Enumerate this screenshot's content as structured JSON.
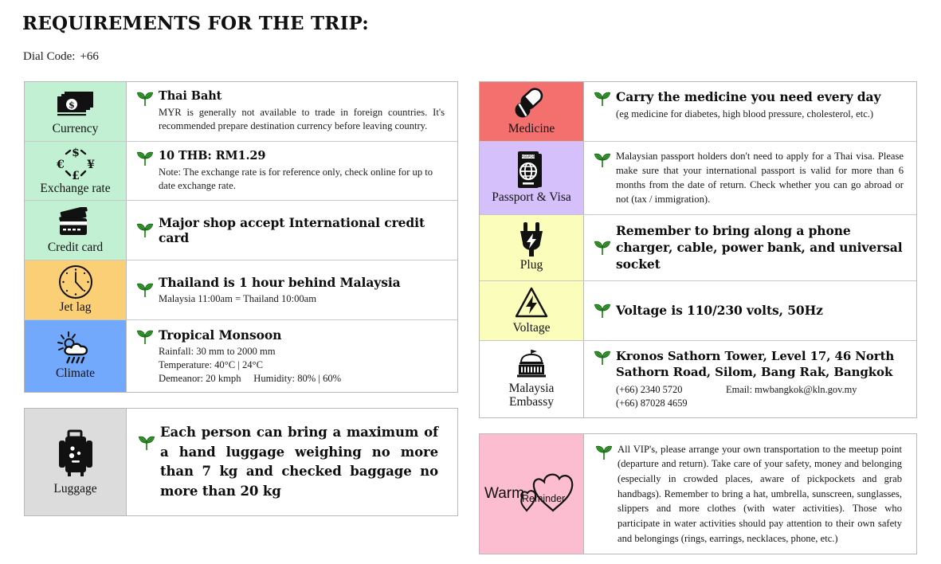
{
  "header": {
    "title": "REQUIREMENTS FOR THE TRIP:",
    "dial_label": "Dial Code:",
    "dial_value": "+66"
  },
  "colors": {
    "mint": "#c2f0d3",
    "orange": "#fbcf76",
    "blue": "#72a9fc",
    "gray": "#dcdcdc",
    "red": "#f4706e",
    "lavender": "#d6c0fc",
    "yellow": "#fbfdbb",
    "pink": "#fcbdd1",
    "white": "#ffffff",
    "border": "#b9b9b9",
    "leaf_green": "#2f8a23"
  },
  "left_table": {
    "rows": [
      {
        "icon": "banknotes-icon",
        "caption": "Currency",
        "cell_color": "#c2f0d3",
        "heading": "Thai Baht",
        "body": "MYR is generally not available to trade in foreign countries. It's recommended prepare destination currency before leaving country."
      },
      {
        "icon": "currency-exchange-icon",
        "caption": "Exchange rate",
        "cell_color": "#c2f0d3",
        "heading": "10 THB: RM1.29",
        "body": "Note: The exchange rate is for reference only, check online for up to date exchange rate."
      },
      {
        "icon": "credit-cards-icon",
        "caption": "Credit card",
        "cell_color": "#c2f0d3",
        "heading": "Major shop accept International credit card",
        "body": ""
      },
      {
        "icon": "clock-icon",
        "caption": "Jet lag",
        "cell_color": "#fbcf76",
        "heading": "Thailand is 1 hour behind Malaysia",
        "body": "Malaysia 11:00am = Thailand 10:00am"
      },
      {
        "icon": "sun-cloud-rain-icon",
        "caption": "Climate",
        "cell_color": "#72a9fc",
        "heading": "Tropical Monsoon",
        "body_lines": [
          "Rainfall: 30 mm to 2000 mm",
          "Temperature: 40°C | 24°C",
          "Demeanor: 20 kmph  Humidity: 80% | 60%"
        ]
      }
    ]
  },
  "left_table_2": {
    "rows": [
      {
        "icon": "suitcase-icon",
        "caption": "Luggage",
        "cell_color": "#dcdcdc",
        "heading": "Each person can bring a maximum of a hand luggage weighing no more than 7 kg and checked baggage no more than 20 kg"
      }
    ]
  },
  "right_table": {
    "rows": [
      {
        "icon": "pills-icon",
        "caption": "Medicine",
        "cell_color": "#f4706e",
        "heading": "Carry the medicine you need every day",
        "body": "(eg medicine for diabetes, high blood pressure, cholesterol, etc.)"
      },
      {
        "icon": "passport-icon",
        "caption": "Passport & Visa",
        "cell_color": "#d6c0fc",
        "body": "Malaysian passport holders don't need to apply for a Thai visa. Please make sure that your international passport is valid for more than 6 months from the date of return. Check whether you can go abroad or not (tax / immigration)."
      },
      {
        "icon": "plug-icon",
        "caption": "Plug",
        "cell_color": "#fbfdbb",
        "heading": "Remember to bring along a phone charger, cable, power bank, and universal socket"
      },
      {
        "icon": "voltage-warning-icon",
        "caption": "Voltage",
        "cell_color": "#fbfdbb",
        "heading": "Voltage is 110/230 volts, 50Hz"
      },
      {
        "icon": "embassy-building-icon",
        "caption_lines": [
          "Malaysia",
          "Embassy"
        ],
        "cell_color": "#ffffff",
        "heading": "Kronos Sathorn Tower, Level 17, 46 North Sathorn Road, Silom, Bang Rak, Bangkok",
        "phone_1": "(+66) 2340 5720",
        "email": "Email: mwbangkok@kln.gov.my",
        "phone_2": "(+66) 87028 4659"
      }
    ]
  },
  "right_table_2": {
    "rows": [
      {
        "icon": "warm-reminder-heart-icon",
        "logo_word_1": "Warm",
        "logo_word_2": "Reminder",
        "cell_color": "#fcbdd1",
        "body": "All VIP's, please arrange your own transportation to the meetup point (departure and return). Take care of your safety, money and belonging (especially in crowded places, aware of pickpockets and grab handbags). Remember to bring a hat, umbrella, sunscreen, sunglasses, slippers and more clothes (with water activities). Those who participate in water activities should pay attention to their own safety and belongings (rings, earrings, necklaces, phone, etc.)"
      }
    ]
  }
}
